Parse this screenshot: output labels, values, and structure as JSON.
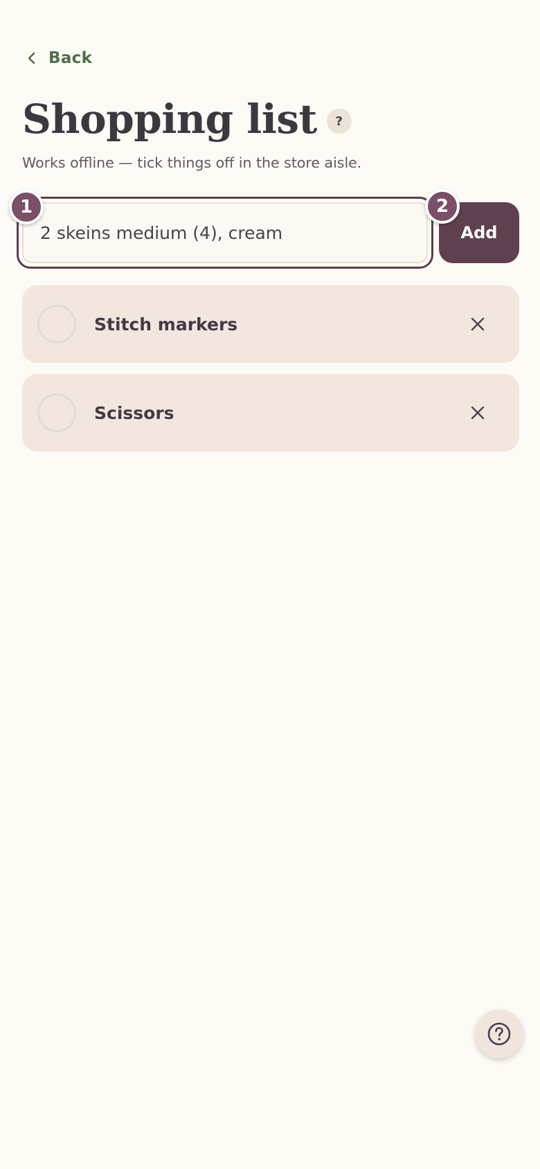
{
  "nav": {
    "back_label": "Back",
    "back_icon": "chevron-left-icon"
  },
  "header": {
    "title": "Shopping list",
    "help_label": "?",
    "subtitle": "Works offline — tick things off in the store aisle."
  },
  "add_form": {
    "input_value": "2 skeins medium (4), cream",
    "add_label": "Add"
  },
  "steps": {
    "step_1": "1",
    "step_2": "2"
  },
  "items": [
    {
      "label": "Stitch markers",
      "checked": false
    },
    {
      "label": "Scissors",
      "checked": false
    }
  ],
  "floating_help": {
    "icon": "help-circle-icon"
  },
  "colors": {
    "background": "#fdfbf5",
    "accent": "#5f4050",
    "badge": "#7a4f67",
    "back_link": "#4d7046",
    "item_background": "#f2e6df"
  }
}
